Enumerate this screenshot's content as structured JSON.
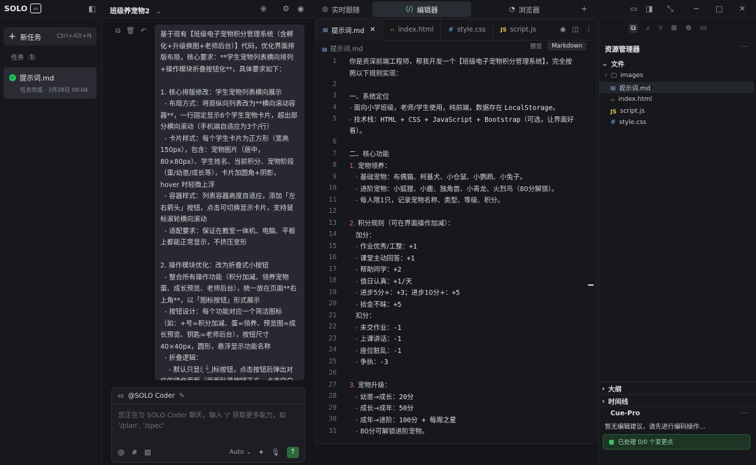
{
  "app": {
    "brand": "SOLO",
    "brand_badge": "▭",
    "project_name": "班级养宠物2",
    "top_tabs": [
      {
        "label": "实时跟随",
        "icon": "follow-icon"
      },
      {
        "label": "编辑器",
        "icon": "code-icon"
      },
      {
        "label": "浏览器",
        "icon": "browser-icon"
      }
    ]
  },
  "sidebar": {
    "new_task_label": "新任务",
    "new_task_shortcut": "Ctrl+Alt+N",
    "tasks_label": "任务",
    "tasks_count": "1",
    "task": {
      "name": "提示词.md",
      "status": "任务完成 · 3月28日 09:04"
    }
  },
  "chat": {
    "message": "基于现有【班级电子宠物积分管理系统（含孵化+升级换图+老师后台）】代码，优化界面排版布局，核心要求：**学生宠物列表横向排列+操作模块折叠按钮化**，具体要求如下：\n\n1. 核心排版修改：学生宠物列表横向展示\n  - 布局方式：将原纵向列表改为**横向滚动容器**，一行固定显示6个学生宠物卡片，超出部分横向滚动（手机端自适应为3个/行）\n  - 卡片样式：每个学生卡片为正方形（宽高150px），包含：宠物图片（居中，80×80px）、学生姓名、当前积分、宠物阶段（蛋/幼崽/成长等），卡片加圆角+阴影，hover 时轻微上浮\n  - 容器样式：列表容器高度自适应，添加「左右箭头」按钮，点击可切换显示卡片，支持鼠标滚轮横向滚动\n  - 适配要求：保证在教室一体机、电脑、平板上都能正常显示，不挤压变形\n\n2. 操作模块优化：改为折叠式小按钮\n  - 整合所有操作功能（积分加减、领养宠物蛋、成长预览、老师后台），统一放在页面**右上角**，以「图标按钮」形式展示\n  - 按钮设计：每个功能对应一个简洁图标（如：+号=积分加减、蛋=领养、预览图=成长预览、钥匙=老师后台），按钮尺寸40×40px，圆形，悬浮显示功能名称\n  - 折叠逻辑：\n    - 默认只显示图标按钮，点击按钮后弹出对应的操作面板（面板贴紧按钮下方，点击空白处自动收起）\n    - 「积分加减」面板：包含学生姓名搜索框、加分/扣分选项、确认按钮",
    "composer_agent": "@SOLO Coder",
    "composer_placeholder": "您正在与 SOLO Coder 聊天，输入 '/' 获取更多能力，如 '/plan', '/spec'",
    "model_label": "Auto"
  },
  "editor": {
    "tabs": [
      {
        "label": "提示词.md",
        "icon": "markdown-icon",
        "active": true
      },
      {
        "label": "index.html",
        "icon": "html-icon",
        "active": false
      },
      {
        "label": "style.css",
        "icon": "css-icon",
        "active": false
      },
      {
        "label": "script.js",
        "icon": "js-icon",
        "active": false
      }
    ],
    "breadcrumb": "提示词.md",
    "mode_preview": "预览",
    "mode_markdown": "Markdown",
    "lines": [
      {
        "n": "1",
        "segs": [
          {
            "t": "你是资深前端工程师，帮我开发一个【班级电子宠物积分管理系统】，完全按",
            "k": "tx"
          }
        ]
      },
      {
        "n": "",
        "segs": [
          {
            "t": "照以下规则实现：",
            "k": "tx"
          }
        ]
      },
      {
        "n": "2",
        "segs": []
      },
      {
        "n": "3",
        "segs": [
          {
            "t": "一、系统定位",
            "k": "tx"
          }
        ]
      },
      {
        "n": "4",
        "segs": [
          {
            "t": "- ",
            "k": "mk"
          },
          {
            "t": "面向小学班级，老师/学生使用，纯前端，数据存在 ",
            "k": "tx"
          },
          {
            "t": "LocalStorage",
            "k": "cd"
          },
          {
            "t": "。",
            "k": "tx"
          }
        ]
      },
      {
        "n": "5",
        "segs": [
          {
            "t": "- ",
            "k": "mk"
          },
          {
            "t": "技术栈：",
            "k": "tx"
          },
          {
            "t": "HTML + CSS + JavaScript + Bootstrap",
            "k": "cd"
          },
          {
            "t": "（可选，让界面好",
            "k": "tx"
          }
        ]
      },
      {
        "n": "",
        "segs": [
          {
            "t": "看）。",
            "k": "tx"
          }
        ]
      },
      {
        "n": "6",
        "segs": []
      },
      {
        "n": "7",
        "segs": [
          {
            "t": "二、核心功能",
            "k": "tx"
          }
        ]
      },
      {
        "n": "8",
        "segs": [
          {
            "t": "1. ",
            "k": "mk"
          },
          {
            "t": "宠物领养：",
            "k": "tx"
          }
        ]
      },
      {
        "n": "9",
        "segs": [
          {
            "t": "   - ",
            "k": "mk"
          },
          {
            "t": "基础宠物：布偶猫、柯基犬、小仓鼠、小鹦鹉、小兔子。",
            "k": "tx"
          }
        ]
      },
      {
        "n": "10",
        "segs": [
          {
            "t": "   - ",
            "k": "mk"
          },
          {
            "t": "进阶宠物：小狐狸、小鹿、独角兽、小青龙、火烈鸟（80分解锁）。",
            "k": "tx"
          }
        ]
      },
      {
        "n": "11",
        "segs": [
          {
            "t": "   - ",
            "k": "mk"
          },
          {
            "t": "每人限1只，记录宠物名称、类型、等级、积分。",
            "k": "tx"
          }
        ]
      },
      {
        "n": "12",
        "segs": []
      },
      {
        "n": "13",
        "segs": [
          {
            "t": "2. ",
            "k": "mk"
          },
          {
            "t": "积分规则（可在界面操作加减）：",
            "k": "tx"
          }
        ]
      },
      {
        "n": "14",
        "segs": [
          {
            "t": "   加分：",
            "k": "tx"
          }
        ]
      },
      {
        "n": "15",
        "segs": [
          {
            "t": "   - ",
            "k": "mk"
          },
          {
            "t": "作业优秀/工整：",
            "k": "tx"
          },
          {
            "t": "+1",
            "k": "cd"
          }
        ]
      },
      {
        "n": "16",
        "segs": [
          {
            "t": "   - ",
            "k": "mk"
          },
          {
            "t": "课堂主动回答：",
            "k": "tx"
          },
          {
            "t": "+1",
            "k": "cd"
          }
        ]
      },
      {
        "n": "17",
        "segs": [
          {
            "t": "   - ",
            "k": "mk"
          },
          {
            "t": "帮助同学：",
            "k": "tx"
          },
          {
            "t": "+2",
            "k": "cd"
          }
        ]
      },
      {
        "n": "18",
        "segs": [
          {
            "t": "   - ",
            "k": "mk"
          },
          {
            "t": "值日认真：",
            "k": "tx"
          },
          {
            "t": "+1/天",
            "k": "cd"
          }
        ]
      },
      {
        "n": "19",
        "segs": [
          {
            "t": "   - ",
            "k": "mk"
          },
          {
            "t": "进步5分+：",
            "k": "tx"
          },
          {
            "t": "+3",
            "k": "cd"
          },
          {
            "t": "；进步10分+：",
            "k": "tx"
          },
          {
            "t": "+5",
            "k": "cd"
          }
        ]
      },
      {
        "n": "20",
        "segs": [
          {
            "t": "   - ",
            "k": "mk"
          },
          {
            "t": "拾金不昧：",
            "k": "tx"
          },
          {
            "t": "+5",
            "k": "cd"
          }
        ]
      },
      {
        "n": "21",
        "segs": [
          {
            "t": "   扣分：",
            "k": "tx"
          }
        ]
      },
      {
        "n": "22",
        "segs": [
          {
            "t": "   - ",
            "k": "mk"
          },
          {
            "t": "未交作业：",
            "k": "tx"
          },
          {
            "t": "-1",
            "k": "cd"
          }
        ]
      },
      {
        "n": "23",
        "segs": [
          {
            "t": "   - ",
            "k": "mk"
          },
          {
            "t": "上课讲话：",
            "k": "tx"
          },
          {
            "t": "-1",
            "k": "cd"
          }
        ]
      },
      {
        "n": "24",
        "segs": [
          {
            "t": "   - ",
            "k": "mk"
          },
          {
            "t": "座位脏乱：",
            "k": "tx"
          },
          {
            "t": "-1",
            "k": "cd"
          }
        ]
      },
      {
        "n": "25",
        "segs": [
          {
            "t": "   - ",
            "k": "mk"
          },
          {
            "t": "争执：",
            "k": "tx"
          },
          {
            "t": "-3",
            "k": "cd"
          }
        ]
      },
      {
        "n": "26",
        "segs": []
      },
      {
        "n": "27",
        "segs": [
          {
            "t": "3. ",
            "k": "mk"
          },
          {
            "t": "宠物升级：",
            "k": "tx"
          }
        ]
      },
      {
        "n": "28",
        "segs": [
          {
            "t": "   - ",
            "k": "mk"
          },
          {
            "t": "幼崽→成长：",
            "k": "tx"
          },
          {
            "t": "20分",
            "k": "cd"
          }
        ]
      },
      {
        "n": "29",
        "segs": [
          {
            "t": "   - ",
            "k": "mk"
          },
          {
            "t": "成长→成年：",
            "k": "tx"
          },
          {
            "t": "50分",
            "k": "cd"
          }
        ]
      },
      {
        "n": "30",
        "segs": [
          {
            "t": "   - ",
            "k": "mk"
          },
          {
            "t": "成年→进阶：",
            "k": "tx"
          },
          {
            "t": "100分 + 每周之星",
            "k": "cd"
          }
        ]
      },
      {
        "n": "31",
        "segs": [
          {
            "t": "   - ",
            "k": "mk"
          },
          {
            "t": "80分可解锁进阶宠物。",
            "k": "tx"
          }
        ]
      }
    ]
  },
  "explorer": {
    "title": "资源管理器",
    "files_section": "文件",
    "items": [
      {
        "name": "images",
        "type": "folder"
      },
      {
        "name": "提示词.md",
        "type": "md"
      },
      {
        "name": "index.html",
        "type": "html"
      },
      {
        "name": "script.js",
        "type": "js"
      },
      {
        "name": "style.css",
        "type": "css"
      }
    ],
    "outline_section": "大纲",
    "timeline_section": "时间线",
    "cue_title": "Cue-Pro",
    "cue_text": "暂无编辑建议，请先进行编码操作...",
    "cue_status": "已处理 0/0 个变更点"
  },
  "colors": {
    "accent_green": "#22c55e",
    "markdown_marker": "#e36b6b"
  }
}
